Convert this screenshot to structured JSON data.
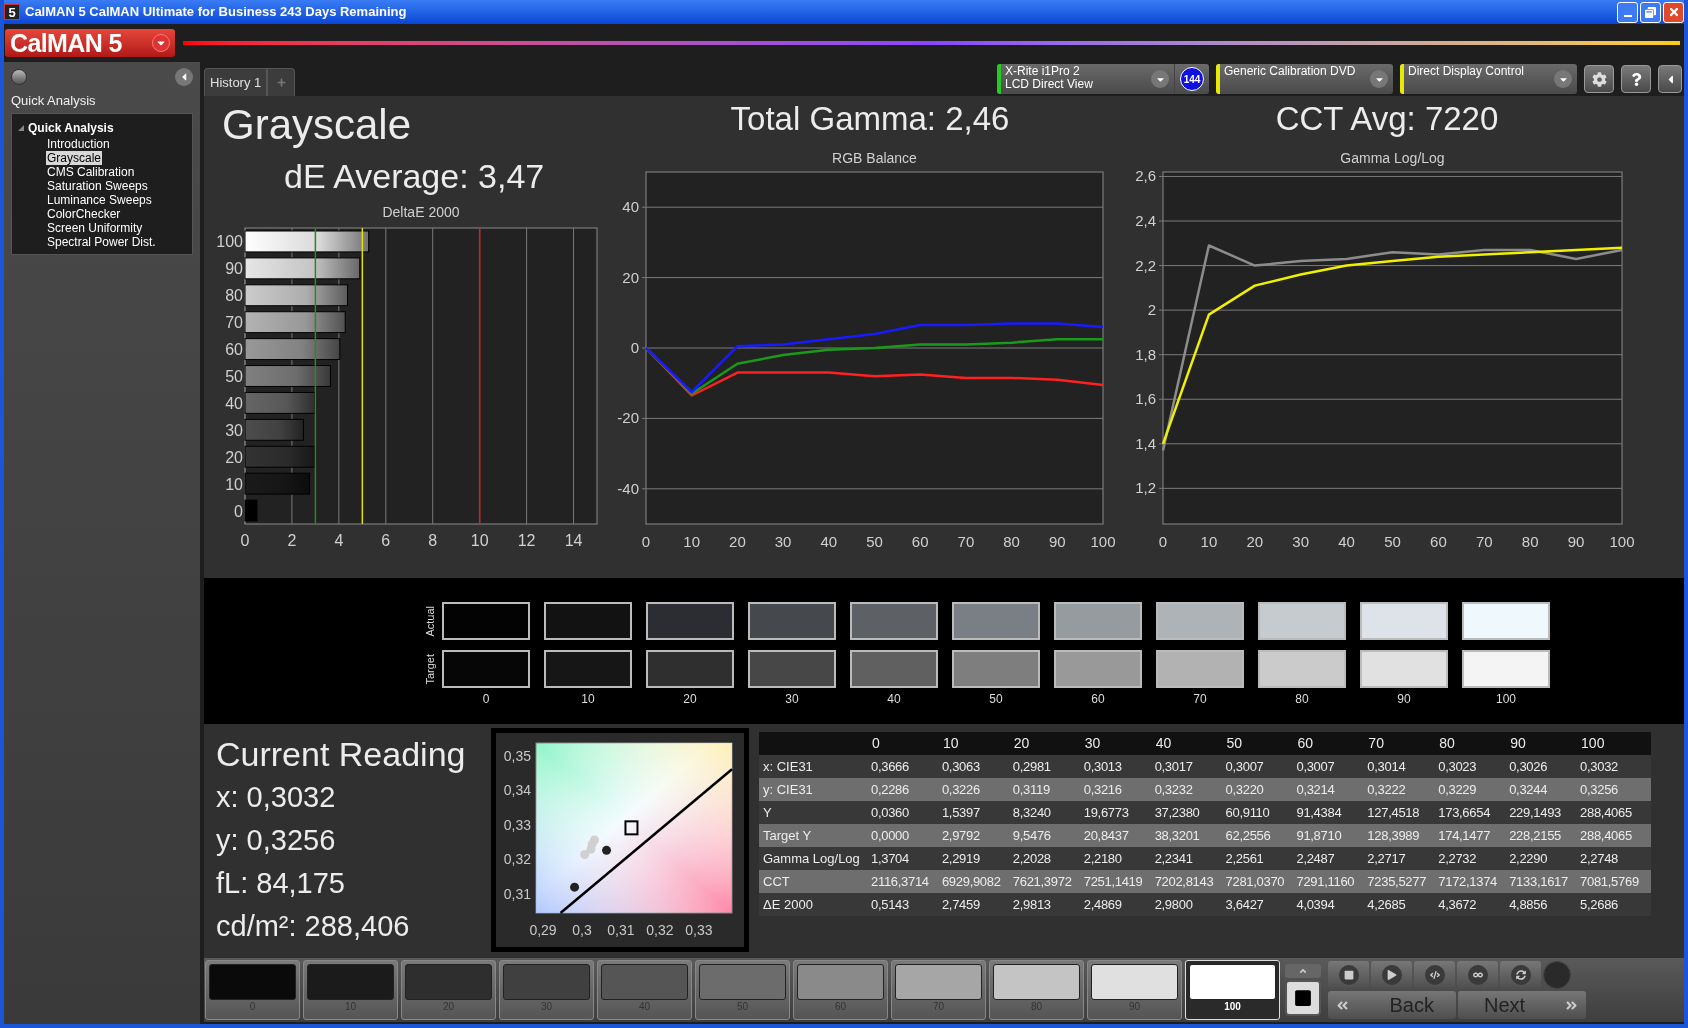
{
  "window": {
    "icon_text": "5",
    "title": "CalMAN 5 CalMAN Ultimate for Business 243 Days Remaining"
  },
  "logo": {
    "text": "CalMAN 5"
  },
  "sidebar": {
    "title": "Quick Analysis",
    "tree": [
      {
        "label": "Quick Analysis",
        "expanded": true,
        "children": [
          {
            "label": "Introduction",
            "selected": false
          },
          {
            "label": "Grayscale",
            "selected": true
          },
          {
            "label": "CMS Calibration",
            "selected": false
          },
          {
            "label": "Saturation Sweeps",
            "selected": false
          },
          {
            "label": "Luminance Sweeps",
            "selected": false
          },
          {
            "label": "ColorChecker",
            "selected": false
          },
          {
            "label": "Screen Uniformity",
            "selected": false
          },
          {
            "label": "Spectral Power Dist.",
            "selected": false
          }
        ]
      }
    ]
  },
  "tabs": [
    {
      "label": "History 1",
      "selected": true
    }
  ],
  "devices": [
    {
      "lines": [
        "X-Rite i1Pro 2",
        "LCD Direct View"
      ],
      "badge": "144",
      "color": "#22cc22"
    },
    {
      "lines": [
        "Generic Calibration DVD"
      ],
      "color": "#e8e800"
    },
    {
      "lines": [
        "Direct Display Control"
      ],
      "color": "#e8e800"
    }
  ],
  "summary": {
    "title": "Grayscale",
    "de_average": "dE Average: 3,47",
    "total_gamma": "Total Gamma: 2,46",
    "cct_avg": "CCT Avg: 7220"
  },
  "deltae": {
    "chart_data": {
      "type": "bar",
      "orientation": "horizontal",
      "title": "DeltaE 2000",
      "categories": [
        "100",
        "90",
        "80",
        "70",
        "60",
        "50",
        "40",
        "30",
        "20",
        "10",
        "0"
      ],
      "values": [
        5.27,
        4.89,
        4.37,
        4.27,
        4.04,
        3.64,
        2.98,
        2.49,
        2.98,
        2.75,
        0.51
      ],
      "xlim": [
        0,
        15
      ],
      "xticks": [
        0,
        2,
        4,
        6,
        8,
        10,
        12,
        14
      ],
      "grid": true,
      "ref_lines": [
        {
          "axis": "x",
          "value": 3,
          "color": "#1f8f1f"
        },
        {
          "axis": "x",
          "value": 5,
          "color": "#e0e000"
        },
        {
          "axis": "x",
          "value": 10,
          "color": "#d02020"
        }
      ]
    }
  },
  "rgb_balance": {
    "chart_data": {
      "type": "line",
      "title": "RGB Balance",
      "x": [
        0,
        10,
        20,
        30,
        40,
        50,
        60,
        70,
        80,
        90,
        100
      ],
      "series": [
        {
          "color": "#ff2020",
          "values": [
            0,
            -13.5,
            -7,
            -7,
            -7,
            -8,
            -7.5,
            -8.5,
            -8.5,
            -9,
            -10.5
          ]
        },
        {
          "color": "#1a9a1a",
          "values": [
            0,
            -13,
            -4.5,
            -2,
            -0.5,
            0,
            1,
            1,
            1.5,
            2.5,
            2.5
          ]
        },
        {
          "color": "#1a1aff",
          "values": [
            0,
            -12.5,
            0.5,
            1,
            2.5,
            4,
            6.5,
            6.5,
            7,
            7,
            6
          ]
        }
      ],
      "xlim": [
        0,
        100
      ],
      "ylim": [
        -50,
        50
      ],
      "xticks": [
        0,
        10,
        20,
        30,
        40,
        50,
        60,
        70,
        80,
        90,
        100
      ],
      "yticks": [
        -40,
        -20,
        0,
        20,
        40
      ],
      "grid": true
    }
  },
  "gamma": {
    "chart_data": {
      "type": "line",
      "title": "Gamma Log/Log",
      "x": [
        0,
        10,
        20,
        30,
        40,
        50,
        60,
        70,
        80,
        90,
        100
      ],
      "series": [
        {
          "color": "#8c8c8c",
          "values": [
            1.37,
            2.29,
            2.2,
            2.22,
            2.23,
            2.26,
            2.25,
            2.27,
            2.27,
            2.23,
            2.27
          ]
        },
        {
          "color": "#f0f000",
          "values": [
            1.4,
            1.98,
            2.11,
            2.16,
            2.2,
            2.22,
            2.24,
            2.25,
            2.26,
            2.27,
            2.28
          ]
        }
      ],
      "xlim": [
        0,
        100
      ],
      "ylim": [
        1.04,
        2.62
      ],
      "xticks": [
        0,
        10,
        20,
        30,
        40,
        50,
        60,
        70,
        80,
        90,
        100
      ],
      "grid": true,
      "yticks": [
        {
          "value": 1.2,
          "label": "1,2"
        },
        {
          "value": 1.4,
          "label": "1,4"
        },
        {
          "value": 1.6,
          "label": "1,6"
        },
        {
          "value": 1.8,
          "label": "1,8"
        },
        {
          "value": 2,
          "label": "2"
        },
        {
          "value": 2.2,
          "label": "2,2"
        },
        {
          "value": 2.4,
          "label": "2,4"
        },
        {
          "value": 2.6,
          "label": "2,6"
        }
      ]
    }
  },
  "swatches": {
    "row_labels": [
      "Actual",
      "Target"
    ],
    "columns": [
      {
        "label": "0",
        "actual": {
          "color": "#030303"
        },
        "target": {
          "color": "#060606"
        }
      },
      {
        "label": "10",
        "actual": {
          "color": "#121212"
        },
        "target": {
          "color": "#161616"
        }
      },
      {
        "label": "20",
        "actual": {
          "color": "#2b2d33"
        },
        "target": {
          "color": "#2f2f2f"
        }
      },
      {
        "label": "30",
        "actual": {
          "color": "#45484d"
        },
        "target": {
          "color": "#474747"
        }
      },
      {
        "label": "40",
        "actual": {
          "color": "#5d6166"
        },
        "target": {
          "color": "#606060"
        }
      },
      {
        "label": "50",
        "actual": {
          "color": "#7a7f85"
        },
        "target": {
          "color": "#7e7e7e"
        }
      },
      {
        "label": "60",
        "actual": {
          "color": "#969ba0"
        },
        "target": {
          "color": "#999999"
        }
      },
      {
        "label": "70",
        "actual": {
          "color": "#aeb3b8"
        },
        "target": {
          "color": "#b2b2b2"
        }
      },
      {
        "label": "80",
        "actual": {
          "color": "#c6cbd0"
        },
        "target": {
          "color": "#cbcbcb"
        }
      },
      {
        "label": "90",
        "actual": {
          "color": "#dde3e8"
        },
        "target": {
          "color": "#e1e1e1"
        }
      },
      {
        "label": "100",
        "actual": {
          "color": "#eef8fd"
        },
        "target": {
          "color": "#f4f4f4"
        }
      }
    ]
  },
  "current_reading": {
    "title": "Current Reading",
    "lines": [
      "x: 0,3032",
      "y: 0,3256",
      "fL: 84,175",
      "cd/m²: 288,406"
    ]
  },
  "cie": {
    "chart_data": {
      "type": "scatter",
      "x": [
        0.3063,
        0.2981,
        0.3007,
        0.3023,
        0.3026,
        0.3032,
        0.3127,
        0.2945,
        0.3385
      ],
      "series": [
        {
          "type": "scatter",
          "marker": "circle",
          "color": "#222222",
          "values": [
            0.3226,
            0.3119,
            null,
            null,
            null,
            null,
            null,
            null,
            null
          ]
        },
        {
          "type": "scatter",
          "marker": "circle",
          "color": "#d0d0d0",
          "values": [
            null,
            null,
            0.3214,
            0.3229,
            0.3244,
            0.3256,
            null,
            null,
            null
          ]
        },
        {
          "type": "scatter",
          "marker": "square",
          "color": "#000000",
          "values": [
            null,
            null,
            null,
            null,
            null,
            null,
            0.329,
            null,
            null
          ]
        },
        {
          "type": "line",
          "color": "#000000",
          "values": [
            null,
            null,
            null,
            null,
            null,
            null,
            null,
            0.3044,
            0.3462
          ]
        }
      ],
      "xlim": [
        0.2882,
        0.3385
      ],
      "ylim": [
        0.3044,
        0.3538
      ],
      "xticks": [
        {
          "value": 0.29,
          "label": "0,29"
        },
        {
          "value": 0.3,
          "label": "0,3"
        },
        {
          "value": 0.31,
          "label": "0,31"
        },
        {
          "value": 0.32,
          "label": "0,32"
        },
        {
          "value": 0.33,
          "label": "0,33"
        }
      ],
      "yticks": [
        {
          "value": 0.31,
          "label": "0,31"
        },
        {
          "value": 0.32,
          "label": "0,32"
        },
        {
          "value": 0.33,
          "label": "0,33"
        },
        {
          "value": 0.34,
          "label": "0,34"
        },
        {
          "value": 0.35,
          "label": "0,35"
        }
      ]
    }
  },
  "table": {
    "columns": [
      "0",
      "10",
      "20",
      "30",
      "40",
      "50",
      "60",
      "70",
      "80",
      "90",
      "100"
    ],
    "rows": [
      {
        "label": "x: CIE31",
        "values": [
          "0,3666",
          "0,3063",
          "0,2981",
          "0,3013",
          "0,3017",
          "0,3007",
          "0,3007",
          "0,3014",
          "0,3023",
          "0,3026",
          "0,3032"
        ]
      },
      {
        "label": "y: CIE31",
        "values": [
          "0,2286",
          "0,3226",
          "0,3119",
          "0,3216",
          "0,3232",
          "0,3220",
          "0,3214",
          "0,3222",
          "0,3229",
          "0,3244",
          "0,3256"
        ]
      },
      {
        "label": "Y",
        "values": [
          "0,0360",
          "1,5397",
          "8,3240",
          "19,6773",
          "37,2380",
          "60,9110",
          "91,4384",
          "127,4518",
          "173,6654",
          "229,1493",
          "288,4065"
        ]
      },
      {
        "label": "Target Y",
        "values": [
          "0,0000",
          "2,9792",
          "9,5476",
          "20,8437",
          "38,3201",
          "62,2556",
          "91,8710",
          "128,3989",
          "174,1477",
          "228,2155",
          "288,4065"
        ]
      },
      {
        "label": "Gamma Log/Log",
        "values": [
          "1,3704",
          "2,2919",
          "2,2028",
          "2,2180",
          "2,2341",
          "2,2561",
          "2,2487",
          "2,2717",
          "2,2732",
          "2,2290",
          "2,2748"
        ]
      },
      {
        "label": "CCT",
        "values": [
          "2116,3714",
          "6929,9082",
          "7621,3972",
          "7251,1419",
          "7202,8143",
          "7281,0370",
          "7291,1160",
          "7235,5277",
          "7172,1374",
          "7133,1617",
          "7081,5769"
        ]
      },
      {
        "label": "ΔE 2000",
        "values": [
          "0,5143",
          "2,7459",
          "2,9813",
          "2,4869",
          "2,9800",
          "3,6427",
          "4,0394",
          "4,2685",
          "4,3672",
          "4,8856",
          "5,2686"
        ]
      }
    ]
  },
  "patches": [
    {
      "label": "0",
      "color": "#0a0a0a",
      "selected": false
    },
    {
      "label": "10",
      "color": "#1b1b1b",
      "selected": false
    },
    {
      "label": "20",
      "color": "#2e2e2e",
      "selected": false
    },
    {
      "label": "30",
      "color": "#404040",
      "selected": false
    },
    {
      "label": "40",
      "color": "#555555",
      "selected": false
    },
    {
      "label": "50",
      "color": "#6c6c6c",
      "selected": false
    },
    {
      "label": "60",
      "color": "#8a8a8a",
      "selected": false
    },
    {
      "label": "70",
      "color": "#a6a6a6",
      "selected": false
    },
    {
      "label": "80",
      "color": "#c4c4c4",
      "selected": false
    },
    {
      "label": "90",
      "color": "#e0e0e0",
      "selected": false
    },
    {
      "label": "100",
      "color": "#ffffff",
      "selected": true
    }
  ],
  "nav": {
    "back": "Back",
    "next": "Next"
  }
}
